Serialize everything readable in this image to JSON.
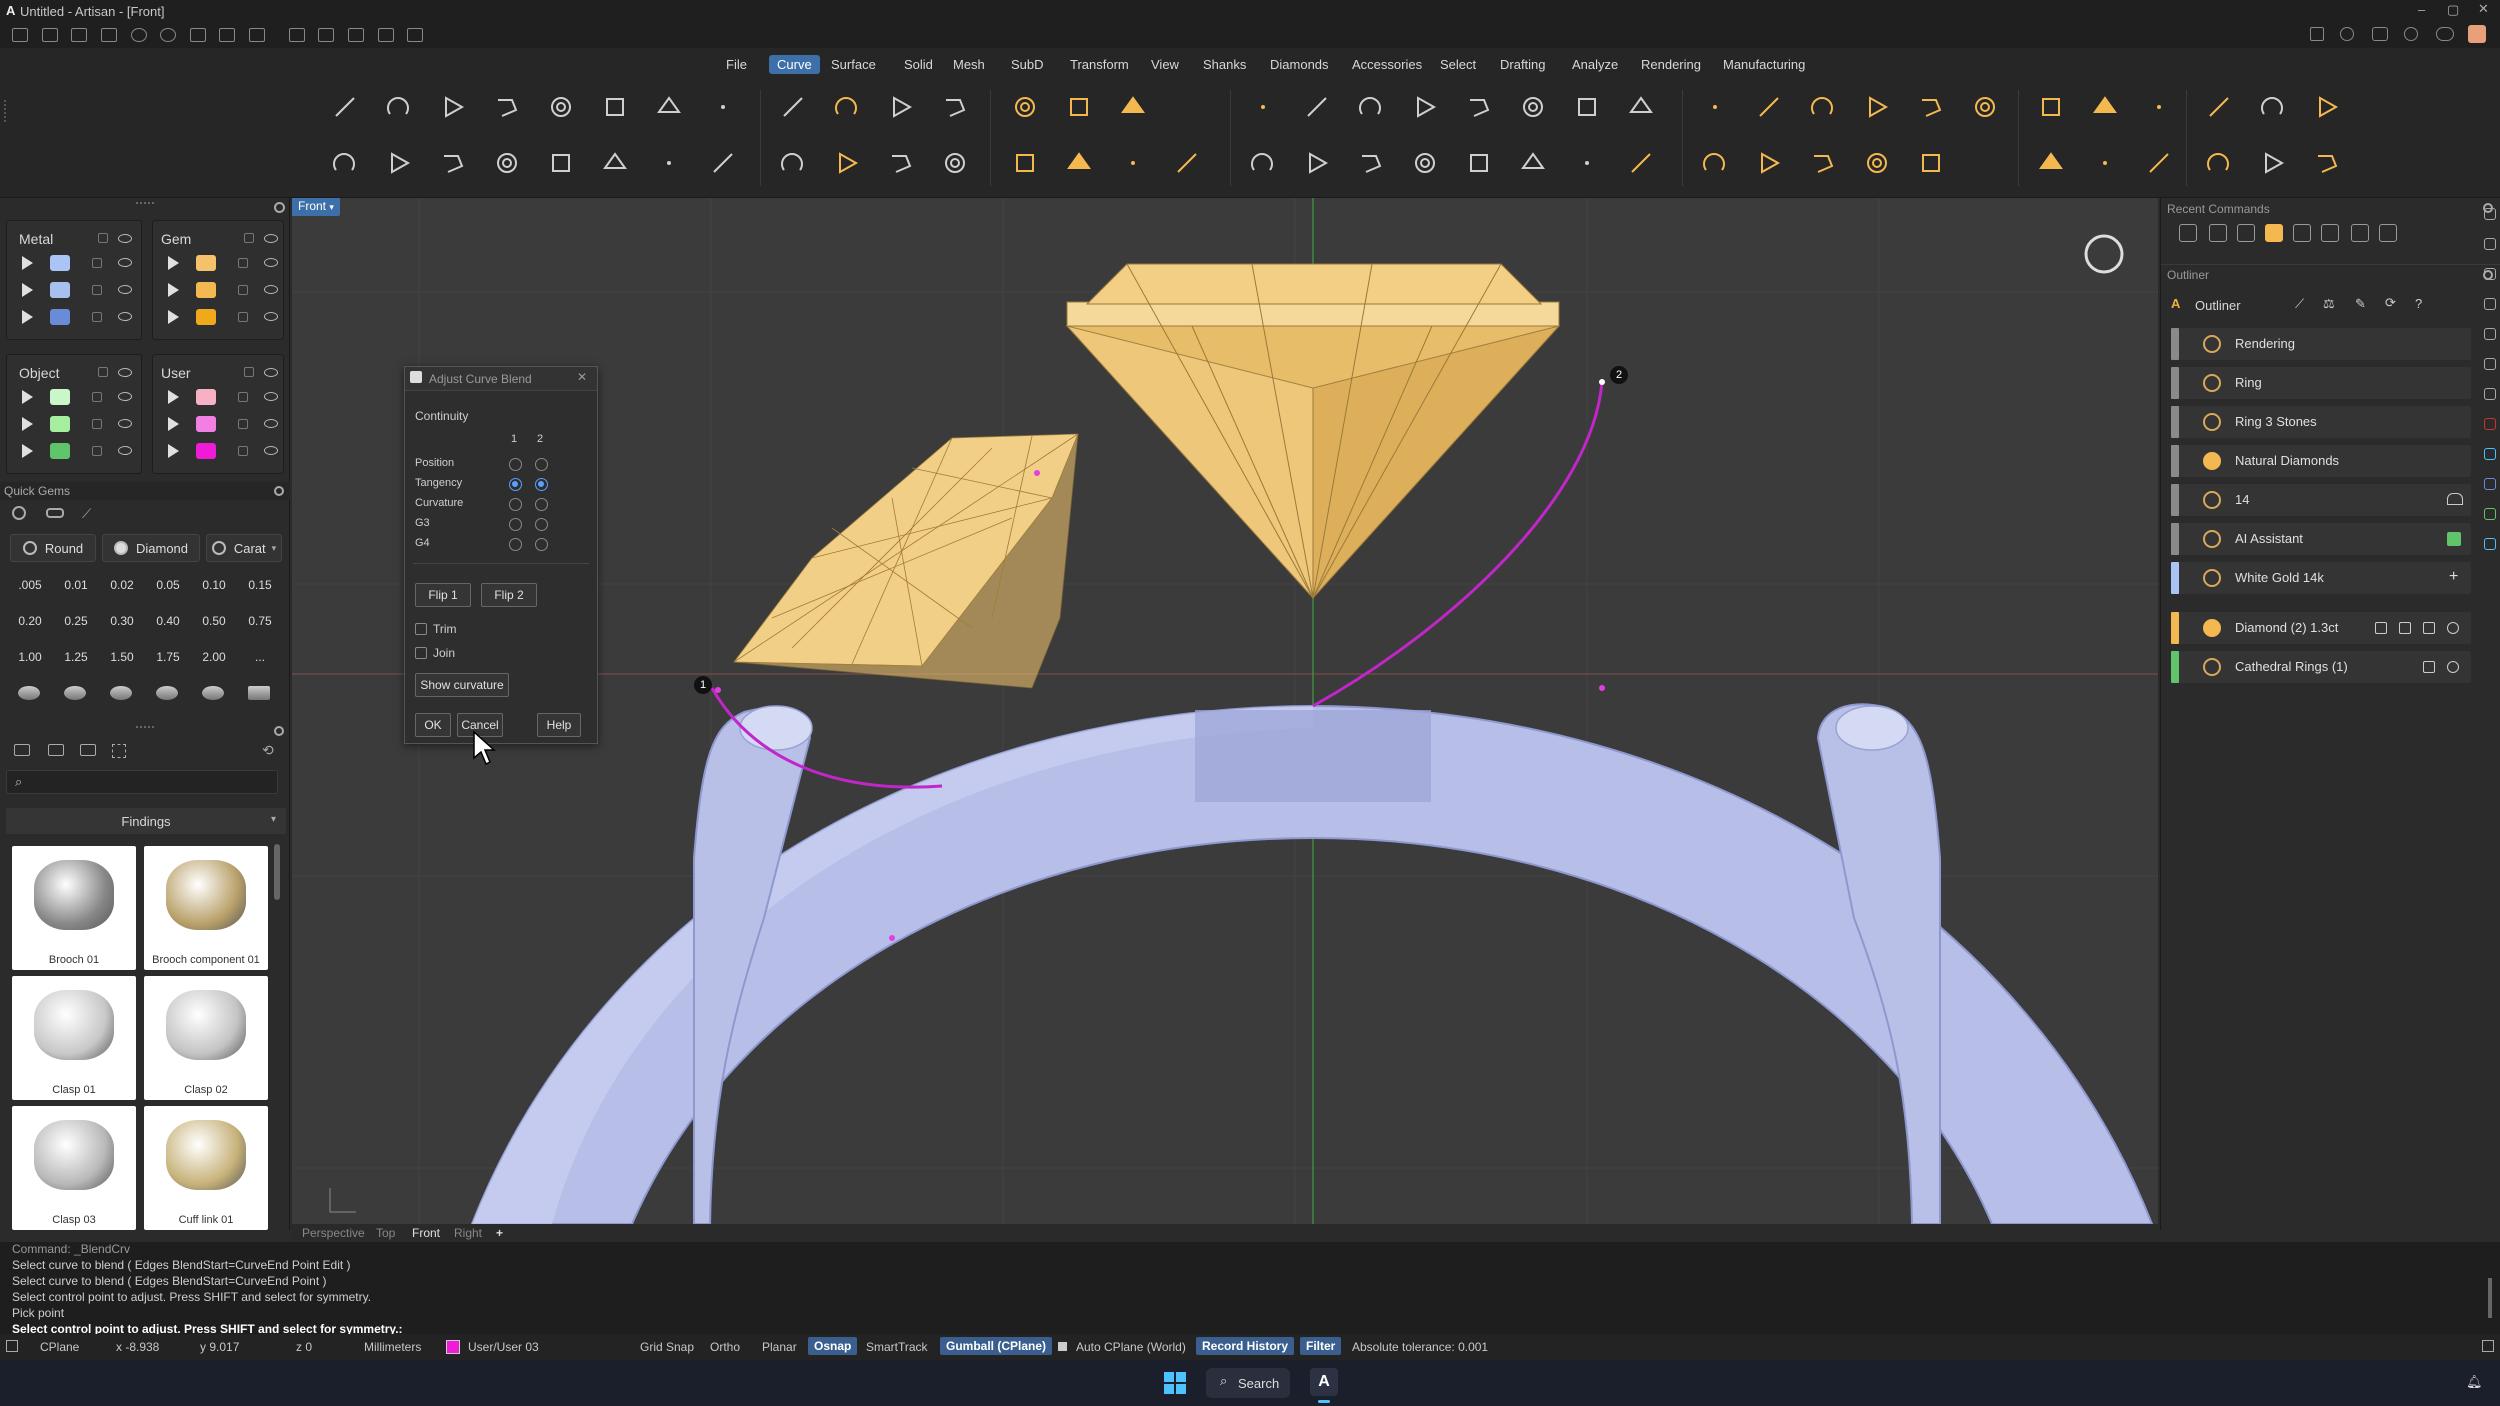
{
  "titlebar": {
    "title": "Untitled - Artisan - [Front]"
  },
  "menu": [
    "File",
    "Curve",
    "Surface",
    "Solid",
    "Mesh",
    "SubD",
    "Transform",
    "View",
    "Shanks",
    "Diamonds",
    "Accessories",
    "Select",
    "Drafting",
    "Analyze",
    "Rendering",
    "Manufacturing"
  ],
  "menu_active": "Curve",
  "layers": {
    "metal": {
      "label": "Metal",
      "colors": [
        "#a9c4f5",
        "#a8c0f0",
        "#6a8bd8"
      ]
    },
    "gem": {
      "label": "Gem",
      "colors": [
        "#f5c26b",
        "#f3b84f",
        "#f0a81c"
      ]
    },
    "object": {
      "label": "Object",
      "colors": [
        "#c9f7c9",
        "#a6eea0",
        "#5fc46a"
      ]
    },
    "user": {
      "label": "User",
      "colors": [
        "#f7b0c4",
        "#f27fe2",
        "#f01bd6"
      ]
    }
  },
  "quick_gems": {
    "title": "Quick Gems",
    "shapes": [
      "Round",
      "Diamond",
      "Carat"
    ],
    "sizes": [
      ".005",
      "0.01",
      "0.02",
      "0.05",
      "0.10",
      "0.15",
      "0.20",
      "0.25",
      "0.30",
      "0.40",
      "0.50",
      "0.75",
      "1.00",
      "1.25",
      "1.50",
      "1.75",
      "2.00",
      "..."
    ]
  },
  "library": {
    "category": "Findings",
    "items": [
      "Brooch 01",
      "Brooch component 01",
      "Clasp 01",
      "Clasp 02",
      "Clasp 03",
      "Cuff link 01"
    ]
  },
  "viewport": {
    "label": "Front",
    "point1": "1",
    "point2": "2",
    "tabs": [
      "Perspective",
      "Top",
      "Front",
      "Right"
    ],
    "active_tab": "Front"
  },
  "dialog": {
    "title": "Adjust Curve Blend",
    "continuity": "Continuity",
    "col1": "1",
    "col2": "2",
    "rows": [
      "Position",
      "Tangency",
      "Curvature",
      "G3",
      "G4"
    ],
    "selected_row": "Tangency",
    "flip1": "Flip 1",
    "flip2": "Flip 2",
    "trim": "Trim",
    "join": "Join",
    "show_curvature": "Show curvature",
    "ok": "OK",
    "cancel": "Cancel",
    "help": "Help"
  },
  "right": {
    "recent_commands": "Recent Commands",
    "outliner_section": "Outliner",
    "outliner_title": "Outliner",
    "items": [
      {
        "label": "Rendering",
        "bar": "#8a8a8a"
      },
      {
        "label": "Ring",
        "bar": "#8a8a8a"
      },
      {
        "label": "Ring 3 Stones",
        "bar": "#8a8a8a"
      },
      {
        "label": "Natural Diamonds",
        "bar": "#8a8a8a"
      },
      {
        "label": "14",
        "bar": "#8a8a8a"
      },
      {
        "label": "AI Assistant",
        "bar": "#8a8a8a"
      },
      {
        "label": "White Gold 14k",
        "bar": "#a9c4f5"
      },
      {
        "label": "Diamond (2) 1.3ct",
        "bar": "#f3b84f"
      },
      {
        "label": "Cathedral Rings (1)",
        "bar": "#5fc46a"
      }
    ]
  },
  "command_history": [
    "Command: _BlendCrv",
    "Select curve to blend ( Edges  BlendStart=CurveEnd  Point  Edit )",
    "Select curve to blend ( Edges  BlendStart=CurveEnd  Point )",
    "Select control point to adjust. Press SHIFT and select for symmetry.",
    "Pick point"
  ],
  "command_prompt": "Select control point to adjust. Press SHIFT and select for symmetry.:",
  "status": {
    "cplane": "CPlane",
    "x": "x -8.938",
    "y": "y 9.017",
    "z": "z 0",
    "units": "Millimeters",
    "layer": "User/User 03",
    "grid_snap": "Grid Snap",
    "ortho": "Ortho",
    "planar": "Planar",
    "osnap": "Osnap",
    "smarttrack": "SmartTrack",
    "gumball": "Gumball (CPlane)",
    "auto_cplane": "Auto CPlane (World)",
    "record_history": "Record History",
    "filter": "Filter",
    "tolerance": "Absolute tolerance: 0.001"
  },
  "taskbar": {
    "search": "Search"
  }
}
